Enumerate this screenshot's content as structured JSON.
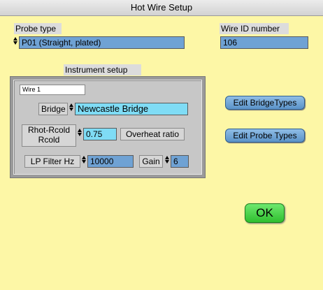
{
  "window": {
    "title": "Hot Wire Setup"
  },
  "probe": {
    "label": "Probe type",
    "value": "P01 (Straight, plated)"
  },
  "wire_id": {
    "label": "Wire ID number",
    "value": "106"
  },
  "instrument": {
    "label": "Instrument setup",
    "wire_name": "Wire 1",
    "bridge_label": "Bridge",
    "bridge_value": "Newcastle Bridge",
    "ratio_label_1": "Rhot-Rcold",
    "ratio_label_2": "Rcold",
    "ratio_value": "0.75",
    "overheat_label": "Overheat ratio",
    "lp_label": "LP Filter Hz",
    "lp_value": "10000",
    "gain_label": "Gain",
    "gain_value": "6"
  },
  "buttons": {
    "edit_bridge": "Edit BridgeTypes",
    "edit_probe": "Edit Probe Types",
    "ok": "OK"
  }
}
